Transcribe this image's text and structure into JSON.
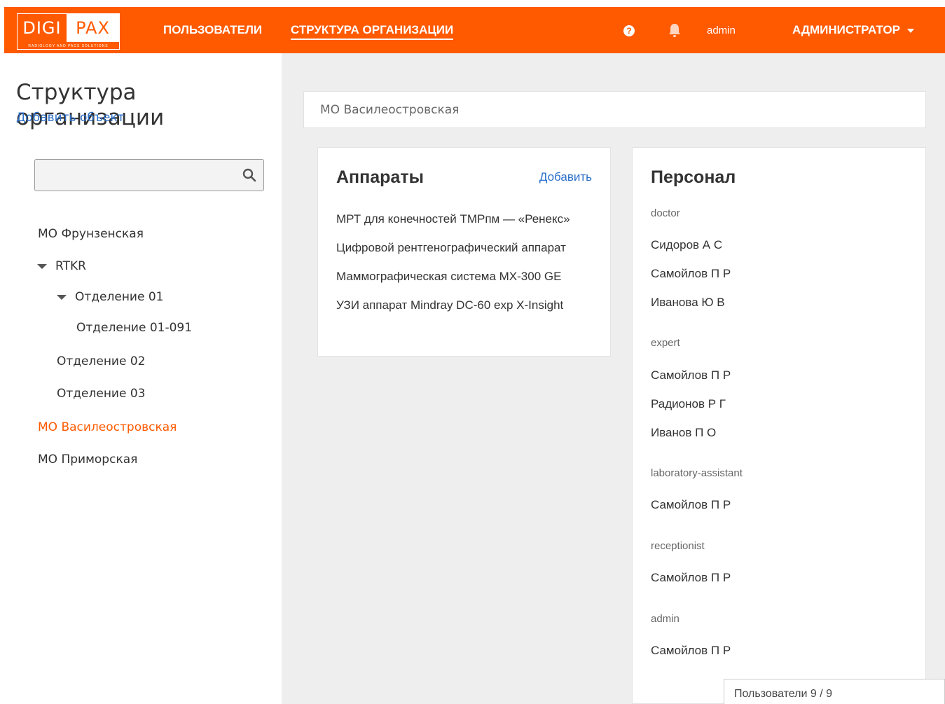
{
  "header": {
    "logo_left": "DIGI",
    "logo_right": "PAX",
    "logo_sub": "RADIOLOGY AND PACS SOLUTIONS",
    "nav_users": "Пользователи",
    "nav_structure": "Структура организации",
    "help_icon": "question-circle-icon",
    "bell_icon": "bell-icon",
    "user_name": "admin",
    "role": "Администратор",
    "accent": "#ff5a00"
  },
  "sidebar": {
    "title": "Структура организации",
    "add_object": "Добавить объект",
    "search_placeholder": "",
    "tree": [
      {
        "label": "МО Фрунзенская"
      },
      {
        "label": "RTKR"
      },
      {
        "label": "Отделение 01"
      },
      {
        "label": "Отделение 01-091"
      },
      {
        "label": "Отделение 02"
      },
      {
        "label": "Отделение 03"
      },
      {
        "label": "МО Василеостровская"
      },
      {
        "label": "МО Приморская"
      }
    ]
  },
  "main": {
    "breadcrumb": "МО Василеостровская",
    "devices": {
      "title": "Аппараты",
      "add": "Добавить",
      "items": [
        "МРТ для конечностей ТМРпм — «Ренекс»",
        "Цифровой рентгенографический аппарат",
        "Маммографическая система MX-300 GE",
        "УЗИ аппарат Mindray DC-60 exp X-Insight"
      ]
    },
    "staff": {
      "title": "Персонал",
      "groups": [
        {
          "role": "doctor",
          "people": [
            "Сидоров А С",
            "Самойлов П Р",
            "Иванова Ю В"
          ]
        },
        {
          "role": "expert",
          "people": [
            "Самойлов П Р",
            "Радионов Р Г",
            "Иванов П О"
          ]
        },
        {
          "role": "laboratory-assistant",
          "people": [
            "Самойлов П Р"
          ]
        },
        {
          "role": "receptionist",
          "people": [
            "Самойлов П Р"
          ]
        },
        {
          "role": "admin",
          "people": [
            "Самойлов П Р"
          ]
        }
      ]
    },
    "users_count": "Пользователи 9 / 9"
  }
}
